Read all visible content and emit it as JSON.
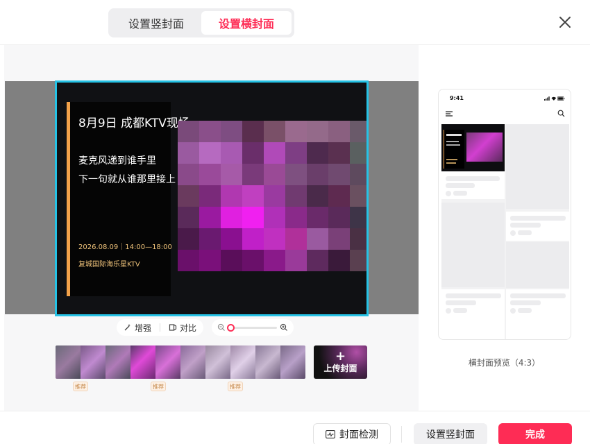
{
  "tabs": [
    {
      "label": "设置竖封面",
      "active": false
    },
    {
      "label": "设置横封面",
      "active": true
    }
  ],
  "cover": {
    "title": "8月9日 成都KTV现场",
    "line1": "麦克风递到谁手里",
    "line2": "下一句就从谁那里接上",
    "datetime": "2026.08.09｜14:00—18:00",
    "venue": "复城国际海乐星KTV"
  },
  "toolbar": {
    "enhance_label": "增强",
    "contrast_label": "对比",
    "zoom_level": 0.0
  },
  "filmstrip": {
    "badge_label": "推荐",
    "upload_label": "上传封面",
    "upload_plus": "+"
  },
  "preview": {
    "status_time": "9:41",
    "caption": "横封面预览（4:3）"
  },
  "footer": {
    "detect_label": "封面检测",
    "vertical_label": "设置竖封面",
    "done_label": "完成"
  },
  "colors": {
    "accent": "#fe2c55",
    "frame_border": "#25c3e6",
    "poster_bar": "#f3a24a"
  }
}
